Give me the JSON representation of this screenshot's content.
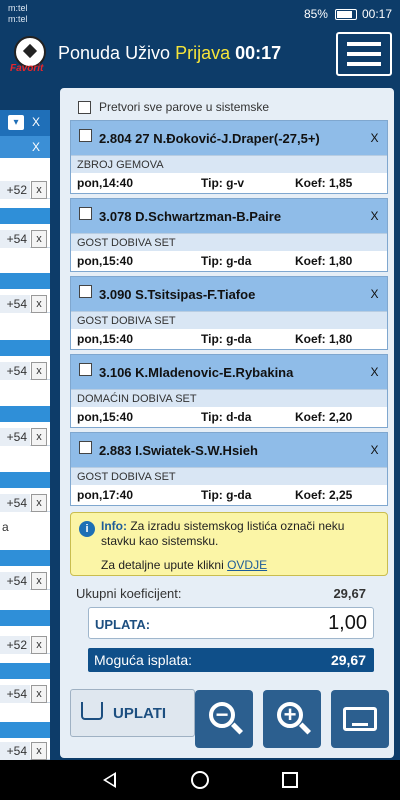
{
  "status_bar": {
    "carrier_1": "m:tel",
    "carrier_2": "m:tel",
    "battery": "85%",
    "time": "00:17"
  },
  "header": {
    "brand": "Favorit",
    "nav_ponuda": "Ponuda",
    "nav_uzivo": "Uživo",
    "nav_prijava": "Prijava",
    "clock": "00:17"
  },
  "left_pane": {
    "values": [
      "+52",
      "+54",
      "+54",
      "+54",
      "+54",
      "+54",
      "+54",
      "+52",
      "+54",
      "+54"
    ],
    "close_label": "x",
    "head_x": "X",
    "fragment": "a"
  },
  "slip": {
    "all_system_label": "Pretvori sve parove u sistemske",
    "bets": [
      {
        "title": "2.804 27  N.Đoković-J.Draper(-27,5+)",
        "market": "ZBROJ GEMOVA",
        "when": "pon,14:40",
        "tip": "Tip: g-v",
        "koef": "Koef: 1,85"
      },
      {
        "title": "3.078  D.Schwartzman-B.Paire",
        "market": "GOST DOBIVA SET",
        "when": "pon,15:40",
        "tip": "Tip: g-da",
        "koef": "Koef: 1,80"
      },
      {
        "title": "3.090  S.Tsitsipas-F.Tiafoe",
        "market": "GOST DOBIVA SET",
        "when": "pon,15:40",
        "tip": "Tip: g-da",
        "koef": "Koef: 1,80"
      },
      {
        "title": "3.106  K.Mladenovic-E.Rybakina",
        "market": "DOMAĆIN DOBIVA SET",
        "when": "pon,15:40",
        "tip": "Tip: d-da",
        "koef": "Koef: 2,20"
      },
      {
        "title": "2.883  I.Swiatek-S.W.Hsieh",
        "market": "GOST DOBIVA SET",
        "when": "pon,17:40",
        "tip": "Tip: g-da",
        "koef": "Koef: 2,25"
      }
    ],
    "remove_label": "X",
    "info": {
      "prefix": "Info:",
      "text": "Za izradu sistemskog listića označi neku stavku kao sistemsku.",
      "link_text": "Za detaljne upute klikni",
      "link": "OVDJE"
    },
    "total_odds_label": "Ukupni koeficijent:",
    "total_odds": "29,67",
    "stake_label": "UPLATA:",
    "stake": "1,00",
    "payout_label": "Moguća isplata:",
    "payout": "29,67",
    "pay_button": "UPLATI"
  },
  "fabs": {
    "zoom_out": "−",
    "zoom_in": "+"
  }
}
